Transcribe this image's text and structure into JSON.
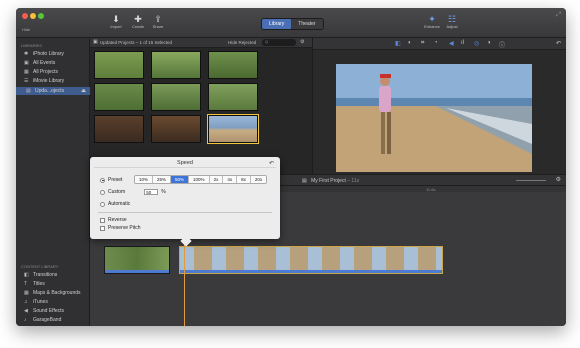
{
  "toolbar": {
    "hide_label": "Hide",
    "import_label": "Import",
    "create_label": "Create",
    "share_label": "Share",
    "tab_library": "Library",
    "tab_theater": "Theater",
    "enhance_label": "Enhance",
    "adjust_label": "Adjust"
  },
  "sidebar": {
    "libraries_header": "LIBRARIES",
    "items": [
      {
        "label": "iPhoto Library",
        "icon": "star-icon"
      },
      {
        "label": "All Events",
        "icon": "film-icon"
      },
      {
        "label": "All Projects",
        "icon": "grid-icon"
      },
      {
        "label": "iMovie Library",
        "icon": "list-icon"
      },
      {
        "label": "Upda...ojects",
        "icon": "folder-icon"
      }
    ],
    "content_header": "CONTENT LIBRARY",
    "content_items": [
      {
        "label": "Transitions"
      },
      {
        "label": "Titles"
      },
      {
        "label": "Maps & Backgrounds"
      },
      {
        "label": "iTunes"
      },
      {
        "label": "Sound Effects"
      },
      {
        "label": "GarageBand"
      }
    ]
  },
  "browser": {
    "title": "Updated Projects – 1 of 15 Selected",
    "hide_rejected": "Hide Rejected",
    "search_placeholder": "Q"
  },
  "timeline": {
    "project_name": "My First Project",
    "duration": "– 11s",
    "ruler_mark": "11.6s"
  },
  "speed_popover": {
    "title": "Speed",
    "preset_label": "Preset",
    "presets": [
      "10%",
      "25%",
      "50%",
      "100%",
      "2x",
      "4x",
      "8x",
      "20x"
    ],
    "selected_preset": "50%",
    "custom_label": "Custom",
    "custom_value": "50",
    "custom_unit": "%",
    "automatic_label": "Automatic",
    "reverse_label": "Reverse",
    "preserve_pitch_label": "Preserve Pitch"
  },
  "colors": {
    "accent": "#3d74d9",
    "selection": "#f0c53b",
    "playhead": "#e29b3b"
  }
}
